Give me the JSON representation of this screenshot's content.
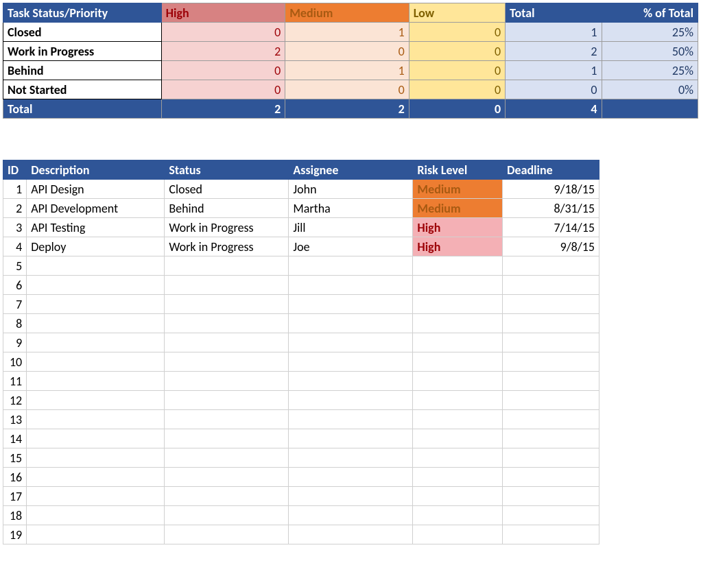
{
  "summary": {
    "header": {
      "status_priority": "Task Status/Priority",
      "high": "High",
      "medium": "Medium",
      "low": "Low",
      "total": "Total",
      "pct": "% of Total"
    },
    "rows": [
      {
        "label": "Closed",
        "high": 0,
        "medium": 1,
        "low": 0,
        "total": 1,
        "pct": "25%"
      },
      {
        "label": "Work in Progress",
        "high": 2,
        "medium": 0,
        "low": 0,
        "total": 2,
        "pct": "50%"
      },
      {
        "label": "Behind",
        "high": 0,
        "medium": 1,
        "low": 0,
        "total": 1,
        "pct": "25%"
      },
      {
        "label": "Not Started",
        "high": 0,
        "medium": 0,
        "low": 0,
        "total": 0,
        "pct": "0%"
      }
    ],
    "totals": {
      "label": "Total",
      "high": 2,
      "medium": 2,
      "low": 0,
      "total": 4,
      "pct": ""
    }
  },
  "detail": {
    "header": {
      "id": "ID",
      "description": "Description",
      "status": "Status",
      "assignee": "Assignee",
      "risk": "Risk Level",
      "deadline": "Deadline"
    },
    "rows": [
      {
        "id": 1,
        "description": "API Design",
        "status": "Closed",
        "assignee": "John",
        "risk": "Medium",
        "risk_class": "risk-med",
        "deadline": "9/18/15"
      },
      {
        "id": 2,
        "description": "API Development",
        "status": "Behind",
        "assignee": "Martha",
        "risk": "Medium",
        "risk_class": "risk-med",
        "deadline": "8/31/15"
      },
      {
        "id": 3,
        "description": "API Testing",
        "status": "Work in Progress",
        "assignee": "Jill",
        "risk": "High",
        "risk_class": "risk-high",
        "deadline": "7/14/15"
      },
      {
        "id": 4,
        "description": "Deploy",
        "status": "Work in Progress",
        "assignee": "Joe",
        "risk": "High",
        "risk_class": "risk-high",
        "deadline": "9/8/15"
      }
    ],
    "empty_ids": [
      5,
      6,
      7,
      8,
      9,
      10,
      11,
      12,
      13,
      14,
      15,
      16,
      17,
      18,
      19
    ]
  },
  "chart_data": {
    "type": "table",
    "title": "Task Status vs Priority Count",
    "categories": [
      "Closed",
      "Work in Progress",
      "Behind",
      "Not Started"
    ],
    "series": [
      {
        "name": "High",
        "values": [
          0,
          2,
          0,
          0
        ]
      },
      {
        "name": "Medium",
        "values": [
          1,
          0,
          1,
          0
        ]
      },
      {
        "name": "Low",
        "values": [
          0,
          0,
          0,
          0
        ]
      }
    ],
    "totals": {
      "row": [
        1,
        2,
        1,
        0
      ],
      "grand": 4,
      "pct_of_total": [
        "25%",
        "50%",
        "25%",
        "0%"
      ]
    }
  }
}
